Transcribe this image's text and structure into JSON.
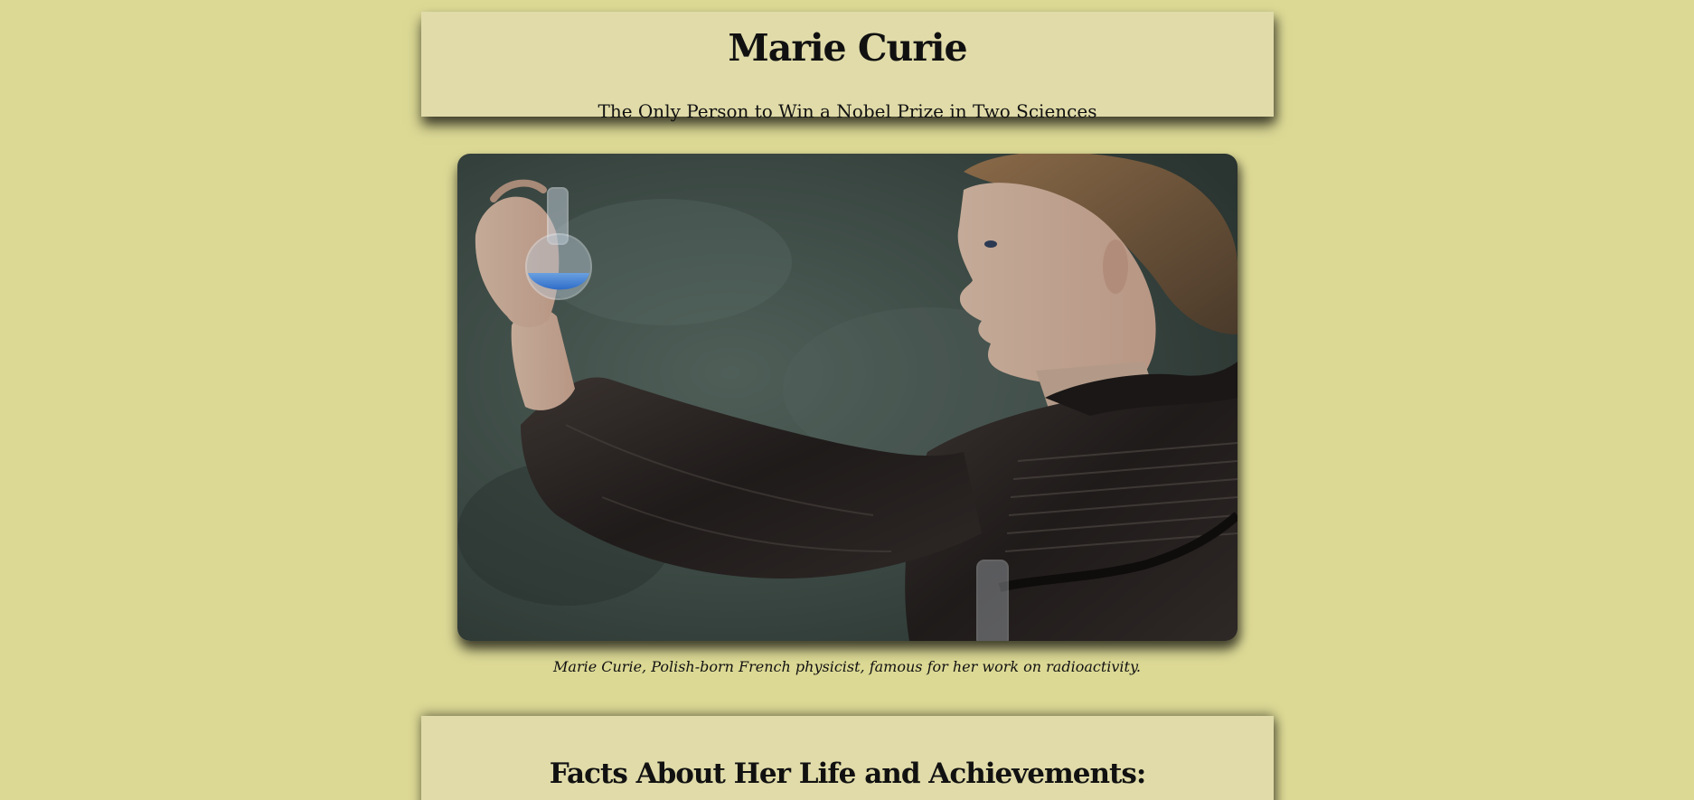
{
  "header": {
    "title": "Marie Curie",
    "subtitle": "The Only Person to Win a Nobel Prize in Two Sciences"
  },
  "figure": {
    "caption": "Marie Curie, Polish-born French physicist, famous for her work on radioactivity."
  },
  "facts": {
    "heading": "Facts About Her Life and Achievements:"
  },
  "colors": {
    "page_background": "#dcd995",
    "card_background": "#e0dba9"
  }
}
